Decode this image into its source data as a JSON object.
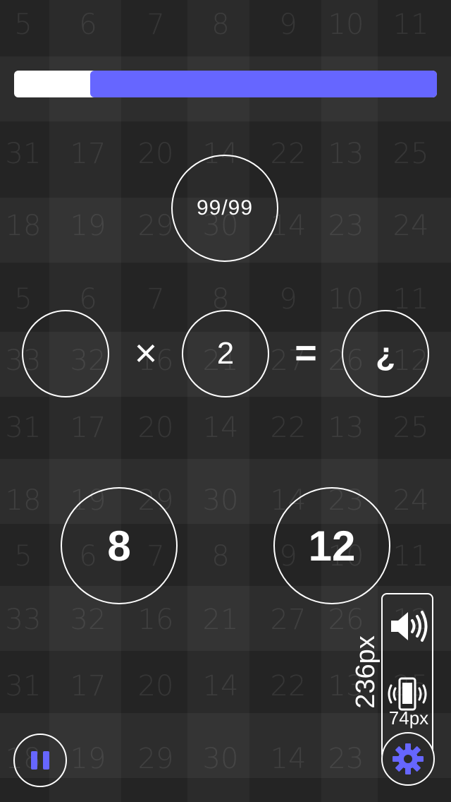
{
  "background": {
    "rows": [
      [
        "5",
        "6",
        "7",
        "8",
        "9",
        "10",
        "11"
      ],
      [
        "31",
        "17",
        "20",
        "14",
        "22",
        "13",
        "25"
      ],
      [
        "18",
        "19",
        "29",
        "30",
        "14",
        "23",
        "24"
      ],
      [
        "5",
        "6",
        "7",
        "8",
        "9",
        "10",
        "11"
      ],
      [
        "33",
        "32",
        "16",
        "21",
        "27",
        "26",
        "12"
      ],
      [
        "31",
        "17",
        "20",
        "14",
        "22",
        "13",
        "25"
      ],
      [
        "18",
        "19",
        "29",
        "30",
        "14",
        "23",
        "24"
      ],
      [
        "5",
        "6",
        "7",
        "8",
        "9",
        "10",
        "11"
      ],
      [
        "33",
        "32",
        "16",
        "21",
        "27",
        "26",
        "12"
      ],
      [
        "31",
        "17",
        "20",
        "14",
        "22",
        "13",
        "25"
      ],
      [
        "18",
        "19",
        "29",
        "30",
        "14",
        "23",
        "24"
      ]
    ]
  },
  "progress": {
    "value_percent": 82,
    "fill_color": "#6666ff",
    "track_color": "#ffffff"
  },
  "score": {
    "text": "99/99"
  },
  "equation": {
    "operand_a": "",
    "operator": "×",
    "operand_b": "2",
    "equals": "=",
    "result": "¿"
  },
  "answers": [
    "8",
    "12"
  ],
  "side_panel": {
    "height_label": "236px",
    "width_label": "74px",
    "sound_icon": "speaker-volume-icon",
    "vibrate_icon": "phone-vibrate-icon"
  },
  "controls": {
    "pause_icon": "pause-icon",
    "settings_icon": "gear-icon",
    "accent_color": "#6666ff"
  }
}
